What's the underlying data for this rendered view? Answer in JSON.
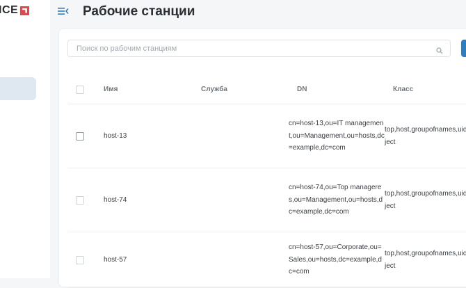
{
  "app": {
    "logo_text": "ICE"
  },
  "header": {
    "title": "Рабочие станции"
  },
  "search": {
    "placeholder": "Поиск по рабочим станциям"
  },
  "table": {
    "columns": [
      "Имя",
      "Служба",
      "DN",
      "Класс"
    ],
    "rows": [
      {
        "name": "host-13",
        "service": "",
        "dn": "cn=host-13,ou=IT management,ou=Management,ou=hosts,dc=example,dc=com",
        "class": "top,host,groupofnames,uidobject"
      },
      {
        "name": "host-74",
        "service": "",
        "dn": "cn=host-74,ou=Top manageres,ou=Management,ou=hosts,dc=example,dc=com",
        "class": "top,host,groupofnames,uidobject"
      },
      {
        "name": "host-57",
        "service": "",
        "dn": "cn=host-57,ou=Corporate,ou=Sales,ou=hosts,dc=example,dc=com",
        "class": "top,host,groupofnames,uidobject"
      }
    ]
  }
}
